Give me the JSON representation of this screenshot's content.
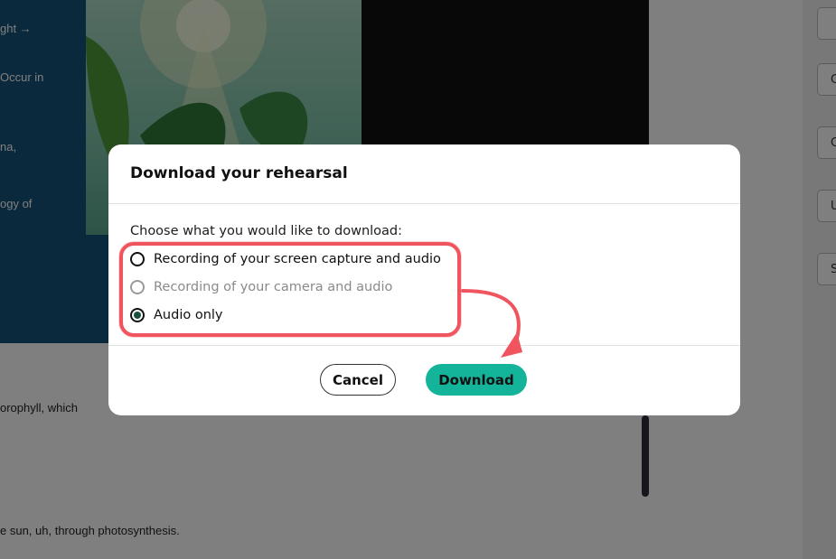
{
  "background": {
    "slide_lines": [
      "ght →",
      "Occur in",
      "na,",
      "ogy of"
    ],
    "transcript_lines": [
      "orophyll, which",
      "e sun, uh, through photosynthesis."
    ],
    "right_panel_letters": [
      "C",
      "C",
      "U",
      "S"
    ]
  },
  "modal": {
    "title": "Download your rehearsal",
    "prompt": "Choose what you would like to download:",
    "options": [
      {
        "label": "Recording of your screen capture and audio",
        "state": "unchecked"
      },
      {
        "label": "Recording of your camera and audio",
        "state": "disabled"
      },
      {
        "label": "Audio only",
        "state": "checked"
      }
    ],
    "cancel_label": "Cancel",
    "download_label": "Download"
  },
  "colors": {
    "accent": "#14b49a",
    "annotation": "#f0545e",
    "radio_selected": "#1b4f3c"
  }
}
